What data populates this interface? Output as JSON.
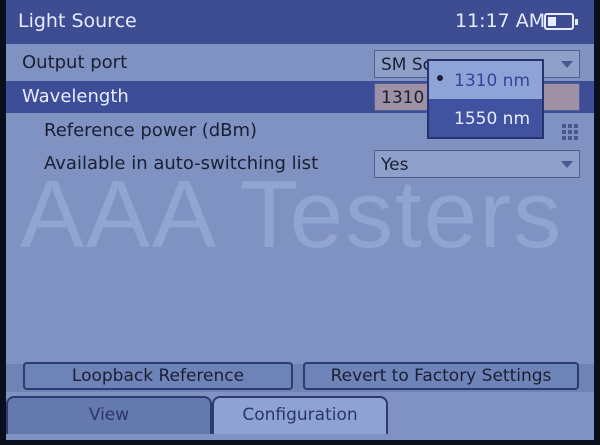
{
  "titlebar": {
    "title": "Light Source",
    "time": "11:17 AM",
    "battery_icon": "battery-icon"
  },
  "settings": {
    "output_port": {
      "label": "Output port",
      "value": "SM Sc"
    },
    "wavelength": {
      "label": "Wavelength",
      "value": "1310"
    },
    "reference_power": {
      "label": "Reference power (dBm)"
    },
    "auto_switching": {
      "label": "Available in auto-switching list",
      "value": "Yes"
    }
  },
  "wavelength_dropdown": {
    "options": [
      "1310 nm",
      "1550 nm"
    ],
    "highlighted": "1310 nm"
  },
  "watermark": "AAA Testers",
  "buttons": {
    "loopback": "Loopback Reference",
    "revert": "Revert to Factory Settings"
  },
  "tabs": {
    "view": "View",
    "configuration": "Configuration",
    "active": "Configuration"
  }
}
